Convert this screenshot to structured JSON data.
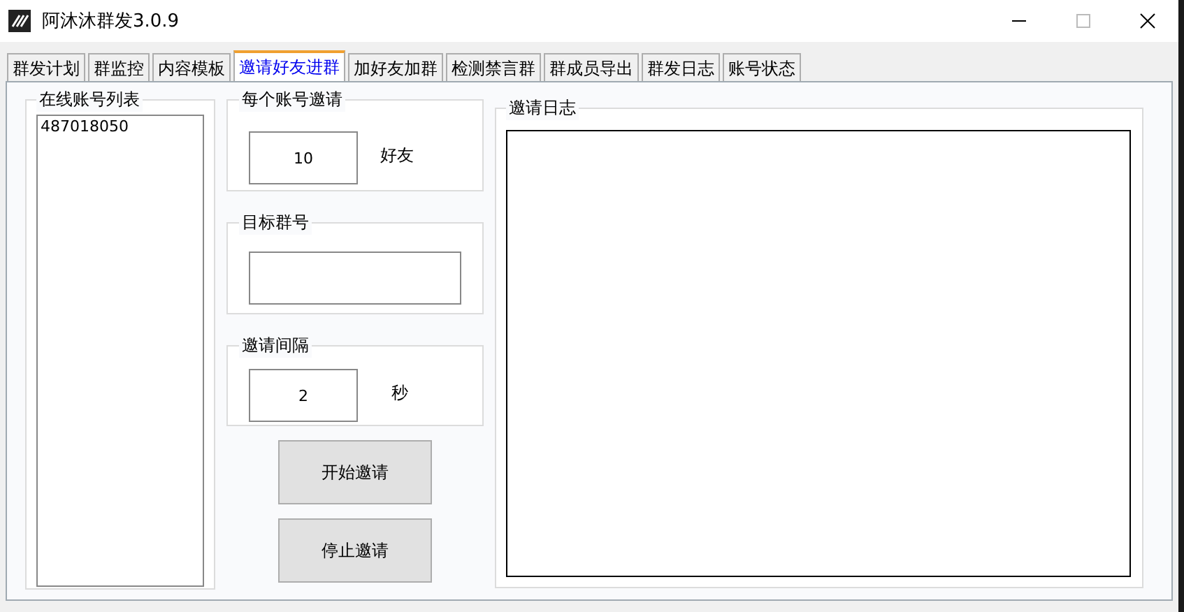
{
  "window": {
    "title": "阿沐沐群发3.0.9"
  },
  "tabs": [
    {
      "label": "群发计划",
      "selected": false
    },
    {
      "label": "群监控",
      "selected": false
    },
    {
      "label": "内容模板",
      "selected": false
    },
    {
      "label": "邀请好友进群",
      "selected": true
    },
    {
      "label": "加好友加群",
      "selected": false
    },
    {
      "label": "检测禁言群",
      "selected": false
    },
    {
      "label": "群成员导出",
      "selected": false
    },
    {
      "label": "群发日志",
      "selected": false
    },
    {
      "label": "账号状态",
      "selected": false
    }
  ],
  "accounts": {
    "title": "在线账号列表",
    "items": [
      "487018050"
    ]
  },
  "per_account": {
    "title": "每个账号邀请",
    "value": "10",
    "unit": "好友"
  },
  "target_group": {
    "title": "目标群号"
  },
  "interval": {
    "title": "邀请间隔",
    "value": "2",
    "unit": "秒"
  },
  "buttons": [
    "开始邀请",
    "停止邀请"
  ],
  "log": {
    "title": "邀请日志"
  }
}
